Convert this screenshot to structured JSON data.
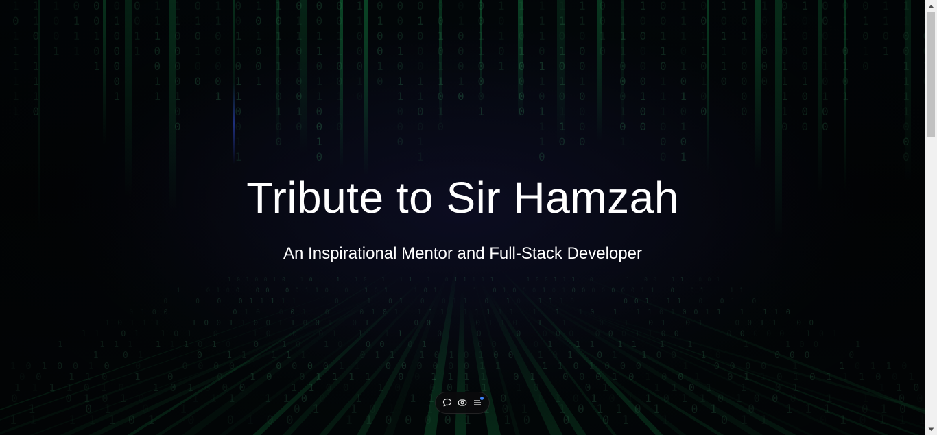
{
  "hero": {
    "title": "Tribute to Sir Hamzah",
    "subtitle": "An Inspirational Mentor and Full-Stack Developer"
  },
  "toolbar": {
    "buttons": [
      {
        "icon": "chat-bubble-icon",
        "name": "comment-button"
      },
      {
        "icon": "eye-icon",
        "name": "view-button"
      },
      {
        "icon": "list-menu-icon",
        "name": "menu-button"
      }
    ]
  },
  "background": {
    "glyphs": [
      "0",
      "1"
    ],
    "accent_color": "#1fd16a",
    "secondary_color": "#2a4bd8"
  }
}
